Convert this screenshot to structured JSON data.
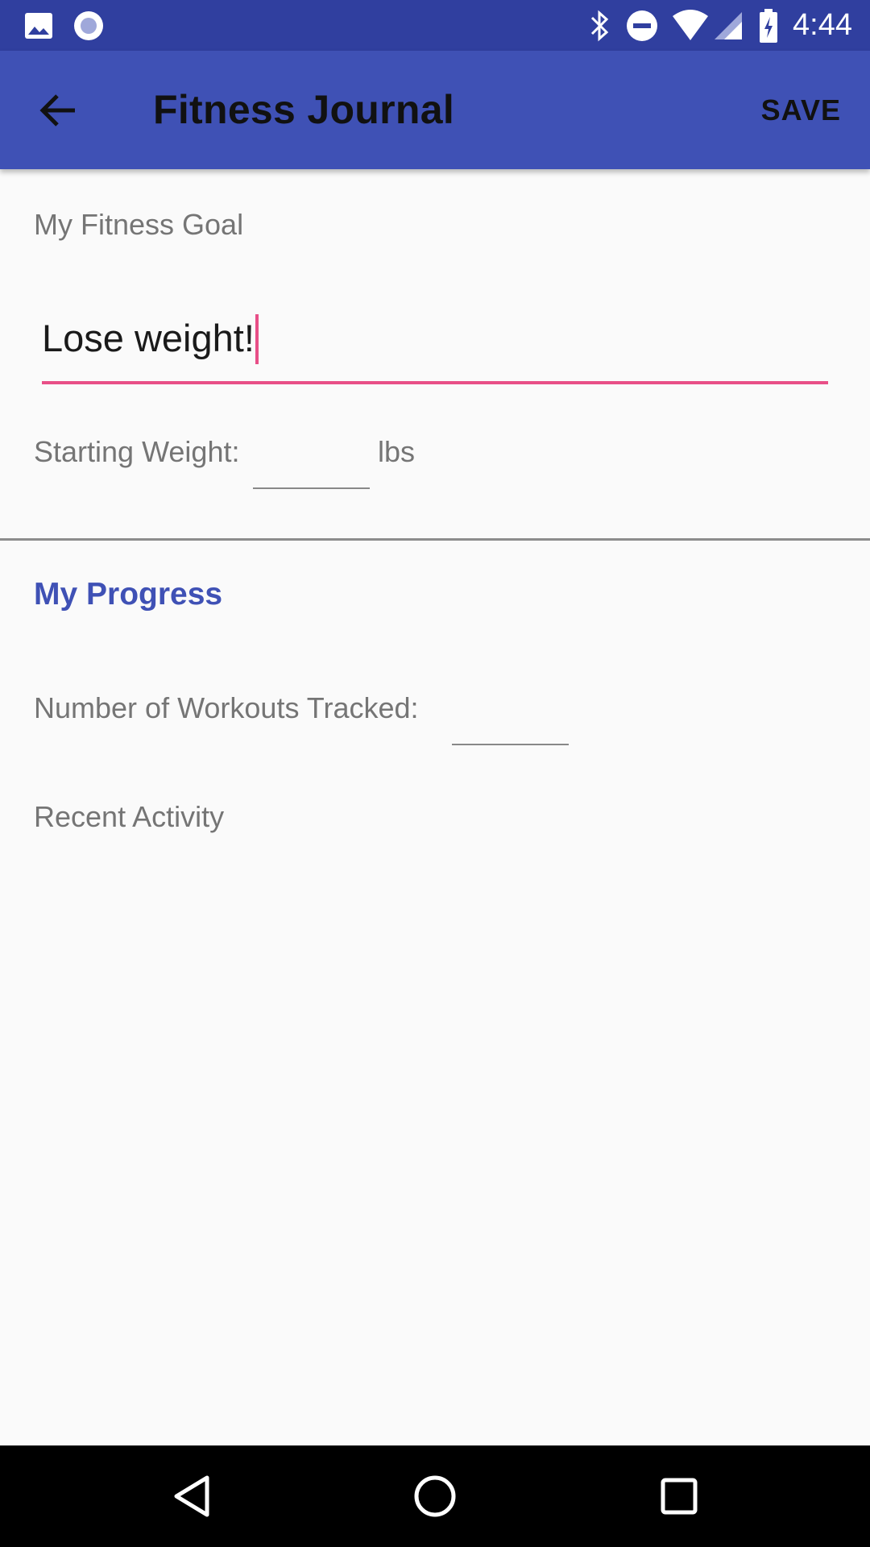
{
  "status_bar": {
    "time": "4:44",
    "icons": [
      "image-icon",
      "sync-icon",
      "bluetooth-icon",
      "do-not-disturb-icon",
      "wifi-icon",
      "signal-icon",
      "battery-charging-icon"
    ]
  },
  "app_bar": {
    "title": "Fitness Journal",
    "save_label": "SAVE"
  },
  "goal": {
    "label": "My Fitness Goal",
    "value": "Lose weight!"
  },
  "starting_weight": {
    "label": "Starting Weight:",
    "value": "",
    "unit": "lbs"
  },
  "progress": {
    "heading": "My Progress",
    "workouts_label": "Number of Workouts Tracked:",
    "workouts_value": "",
    "recent_activity_label": "Recent Activity"
  },
  "colors": {
    "status_bar": "#303f9f",
    "app_bar": "#3f51b5",
    "accent": "#e84f87",
    "section_heading": "#3f51b5"
  }
}
